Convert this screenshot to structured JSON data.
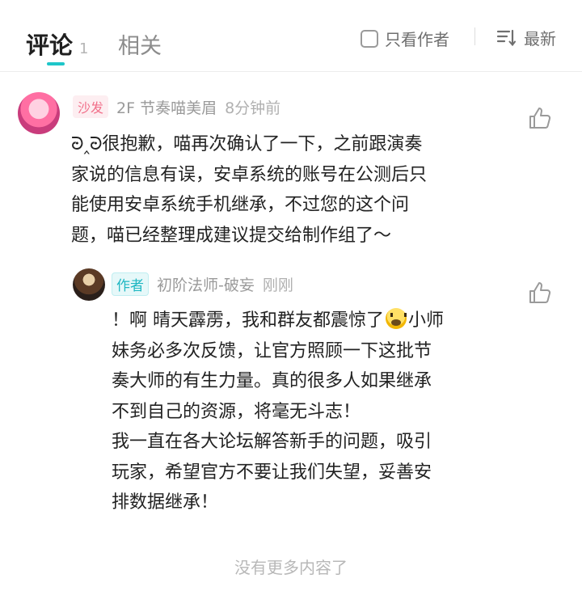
{
  "tabs": {
    "comments_label": "评论",
    "comments_count": "1",
    "related_label": "相关"
  },
  "filters": {
    "author_only_label": "只看作者",
    "sort_label": "最新"
  },
  "comment": {
    "badge": "沙发",
    "floor_user": "2F 节奏喵美眉",
    "time": "8分钟前",
    "lines": [
      "ᘒ‸ᘒ很抱歉，喵再次确认了一下，之前跟演奏",
      "家说的信息有误，安卓系统的账号在公测后只",
      "能使用安卓系统手机继承，不过您的这个问",
      "题，喵已经整理成建议提交给制作组了～"
    ]
  },
  "reply": {
    "badge": "作者",
    "user": "初阶法师-破妄",
    "time": "刚刚",
    "line1_before_emoji": "！啊 晴天霹雳，我和群友都震惊了",
    "line1_after_emoji": "小师",
    "lines": [
      "妹务必多次反馈，让官方照顾一下这批节",
      "奏大师的有生力量。真的很多人如果继承",
      "不到自己的资源，将毫无斗志！",
      "我一直在各大论坛解答新手的问题，吸引",
      "玩家，希望官方不要让我们失望，妥善安",
      "排数据继承！"
    ]
  },
  "footer_text": "没有更多内容了",
  "icons": {
    "checkbox": "checkbox-icon",
    "sort": "sort-icon",
    "like": "thumbs-up-icon",
    "emoji": "scream-emoji-icon"
  },
  "colors": {
    "accent": "#1ec6c9",
    "sofa_badge": "#f1708a",
    "author_badge": "#1fb7c2"
  }
}
